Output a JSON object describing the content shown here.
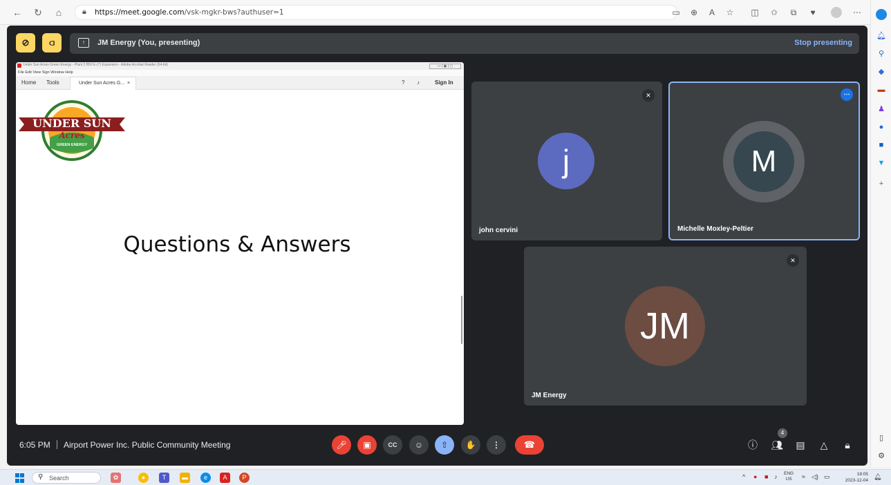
{
  "browser": {
    "url_domain": "https://meet.google.com",
    "url_path": "/vsk-mgkr-bws?authuser=1"
  },
  "meet": {
    "presenting_label": "JM Energy (You, presenting)",
    "stop_presenting": "Stop presenting",
    "time": "6:05 PM",
    "meeting_name": "Airport Power Inc. Public Community Meeting",
    "participant_count": "4"
  },
  "shared": {
    "window_title": "Under Sun Acres Green Energy - Plant 2 B50 E-(7) Expansion - Adobe Acrobat Reader (64-bit)",
    "menu": "File  Edit  View  Sign  Window  Help",
    "tab_home": "Home",
    "tab_tools": "Tools",
    "doc_tab": "Under Sun Acres G...",
    "doc_tab_close": "×",
    "sign_in": "Sign In",
    "logo_text_top": "UNDER SUN",
    "logo_text_mid": "Acres",
    "logo_text_bottom": "GREEN ENERGY",
    "slide_title": "Questions & Answers"
  },
  "participants": [
    {
      "name": "john cervini",
      "initial": "j",
      "avatar_color": "#5c6bc0"
    },
    {
      "name": "Michelle Moxley-Peltier",
      "initial": "M",
      "avatar_color": "#37474f"
    },
    {
      "name": "JM Energy",
      "initial": "JM",
      "avatar_color": "#6d4c41"
    }
  ],
  "taskbar": {
    "search": "Search",
    "lang_top": "ENG",
    "lang_bottom": "US",
    "time": "18:05",
    "date": "2023-12-04"
  },
  "colors": {
    "meet_bg": "#202124",
    "tile_bg": "#3c4043",
    "accent_blue": "#8ab4f8",
    "danger_red": "#ea4335",
    "highlight": "#fdd663"
  }
}
